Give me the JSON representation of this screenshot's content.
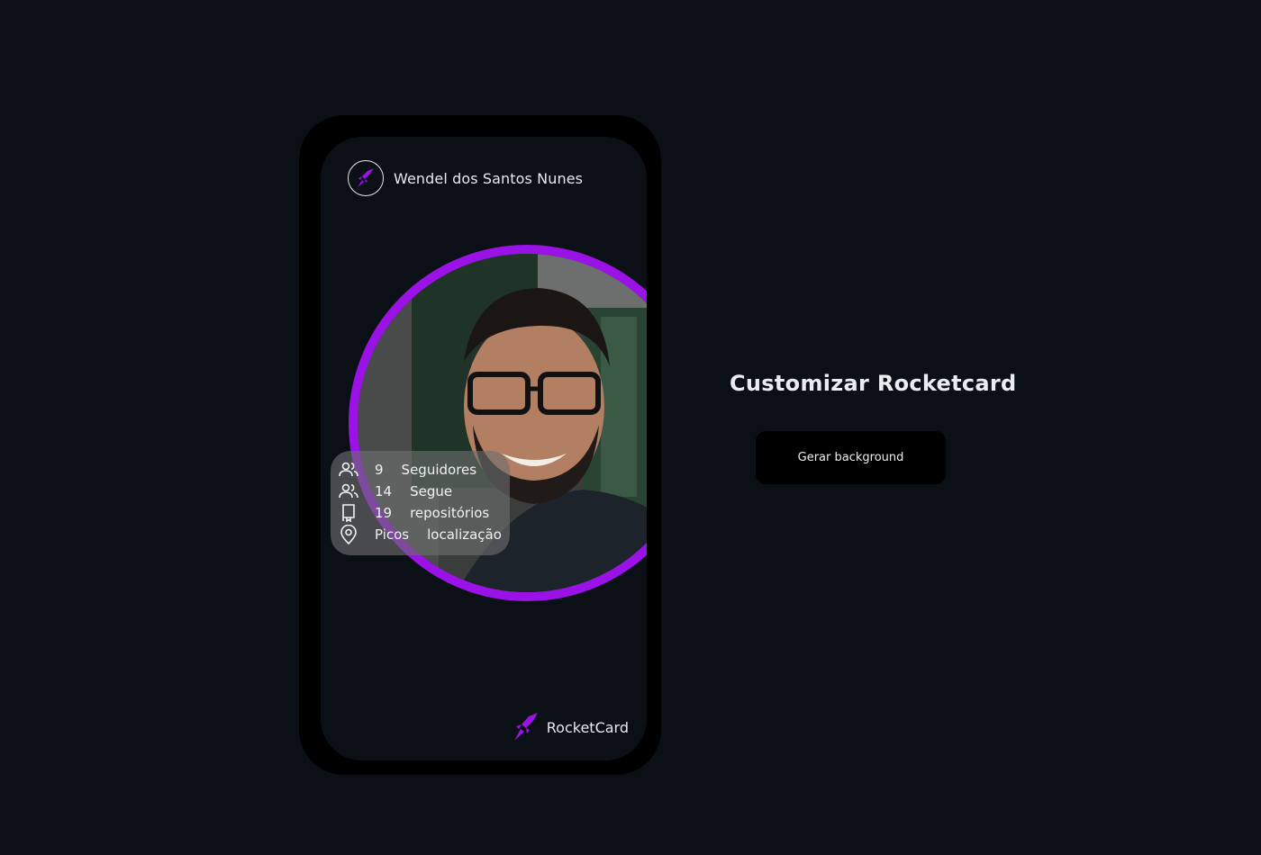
{
  "card": {
    "user_name": "Wendel dos Santos Nunes",
    "stats": [
      {
        "icon": "users-icon",
        "value": "9",
        "label": "Seguidores"
      },
      {
        "icon": "users-icon",
        "value": "14",
        "label": "Segue"
      },
      {
        "icon": "repository-icon",
        "value": "19",
        "label": "repositórios"
      },
      {
        "icon": "map-pin-icon",
        "value": "Picos",
        "label": "localização"
      }
    ],
    "brand_name": "RocketCard"
  },
  "customize": {
    "title": "Customizar Rocketcard",
    "button_label": "Gerar background"
  },
  "colors": {
    "accent": "#9a12e6",
    "background": "#0b1017",
    "frame": "#000000"
  }
}
